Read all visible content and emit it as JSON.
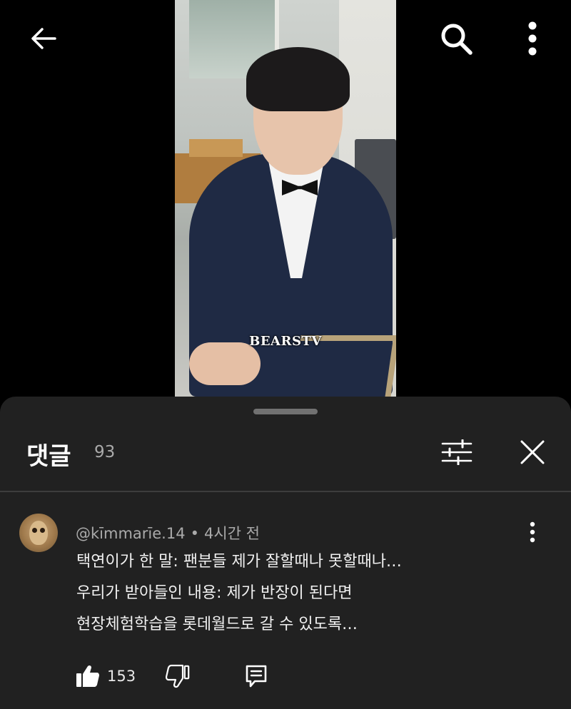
{
  "video": {
    "watermark_main": "BEARS",
    "watermark_suffix": "TV"
  },
  "top_bar": {
    "back_icon": "arrow-left-icon",
    "search_icon": "search-icon",
    "more_icon": "more-vertical-icon"
  },
  "comments": {
    "title": "댓글",
    "count": "93",
    "filter_icon": "sliders-icon",
    "close_icon": "close-icon",
    "items": [
      {
        "author": "@kīmmarīe.14",
        "separator": "•",
        "time": "4시간 전",
        "lines": [
          "택연이가 한 말: 팬분들 제가 잘할때나 못할때나…",
          "우리가 받아들인 내용: 제가 반장이 된다면",
          "현장체험학습을 롯데월드로 갈 수 있도록…"
        ],
        "likes": "153",
        "like_icon": "thumbs-up-icon",
        "dislike_icon": "thumbs-down-icon",
        "reply_icon": "reply-comment-icon",
        "more_icon": "more-vertical-icon"
      }
    ]
  },
  "colors": {
    "background": "#000000",
    "sheet": "#212121",
    "text_primary": "#f1f1f1",
    "text_secondary": "#aaaaaa"
  }
}
